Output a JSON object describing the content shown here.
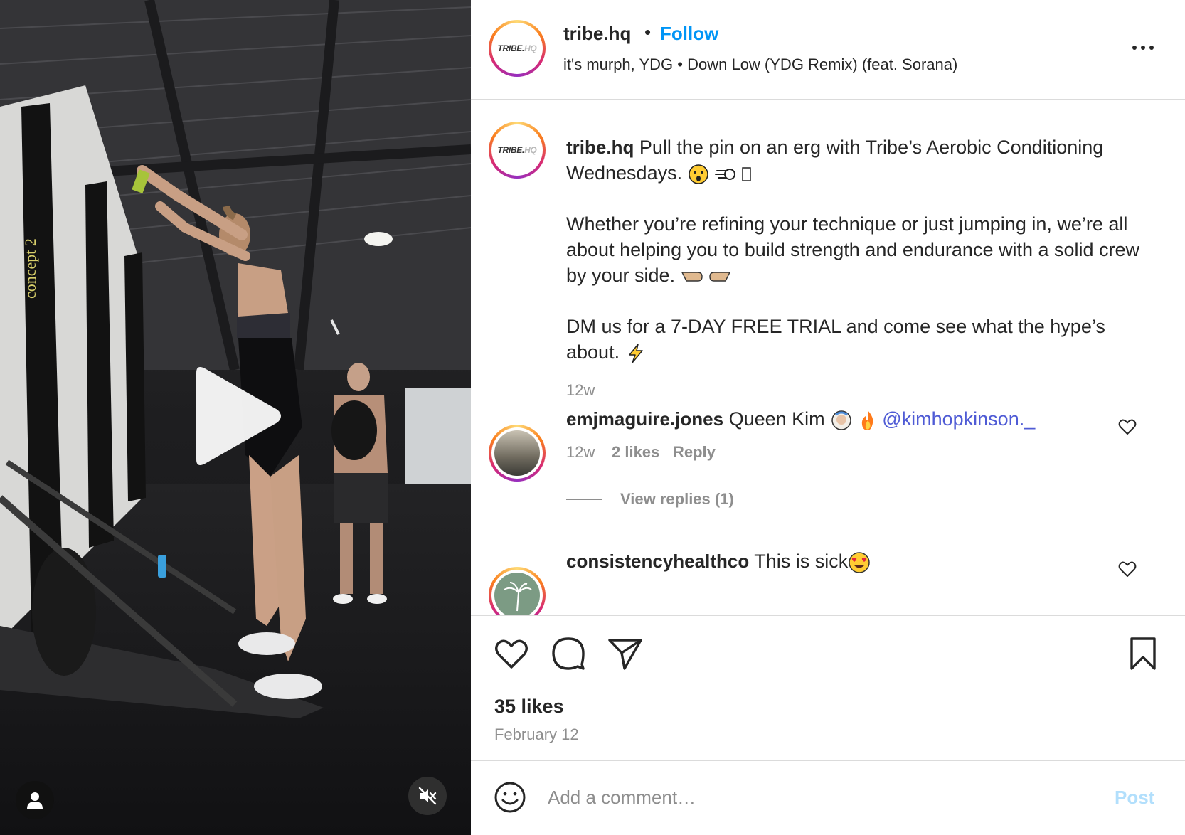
{
  "header": {
    "username": "tribe.hq",
    "separator": "•",
    "follow_label": "Follow",
    "audio": "it's murph, YDG • Down Low (YDG Remix) (feat. Sorana)",
    "avatar_text_bold": "TRIBE.",
    "avatar_text_light": "HQ"
  },
  "caption": {
    "username": "tribe.hq",
    "line1": "Pull the pin on an erg with Tribe’s Aerobic Conditioning Wednesdays.",
    "paragraph2": "Whether you’re refining your technique or just jumping in, we’re all about helping you to build strength and endurance with a solid crew by your side.",
    "paragraph3": "DM us for a 7-DAY FREE TRIAL and come see what the hype’s about.",
    "time": "12w"
  },
  "comments": [
    {
      "username": "emjmaguire.jones",
      "text": "Queen Kim",
      "mention": "@kimhopkinson._",
      "time": "12w",
      "likes": "2 likes",
      "reply_label": "Reply",
      "view_replies": "View replies (1)"
    },
    {
      "username": "consistencyhealthco",
      "text": "This is sick"
    }
  ],
  "stats": {
    "likes": "35 likes",
    "date": "February 12"
  },
  "composer": {
    "placeholder": "Add a comment…",
    "post_label": "Post"
  },
  "colors": {
    "accent_blue": "#0095f6",
    "mention": "#4f5bd5",
    "muted": "#8e8e8e",
    "post_disabled": "#b2dffc"
  }
}
